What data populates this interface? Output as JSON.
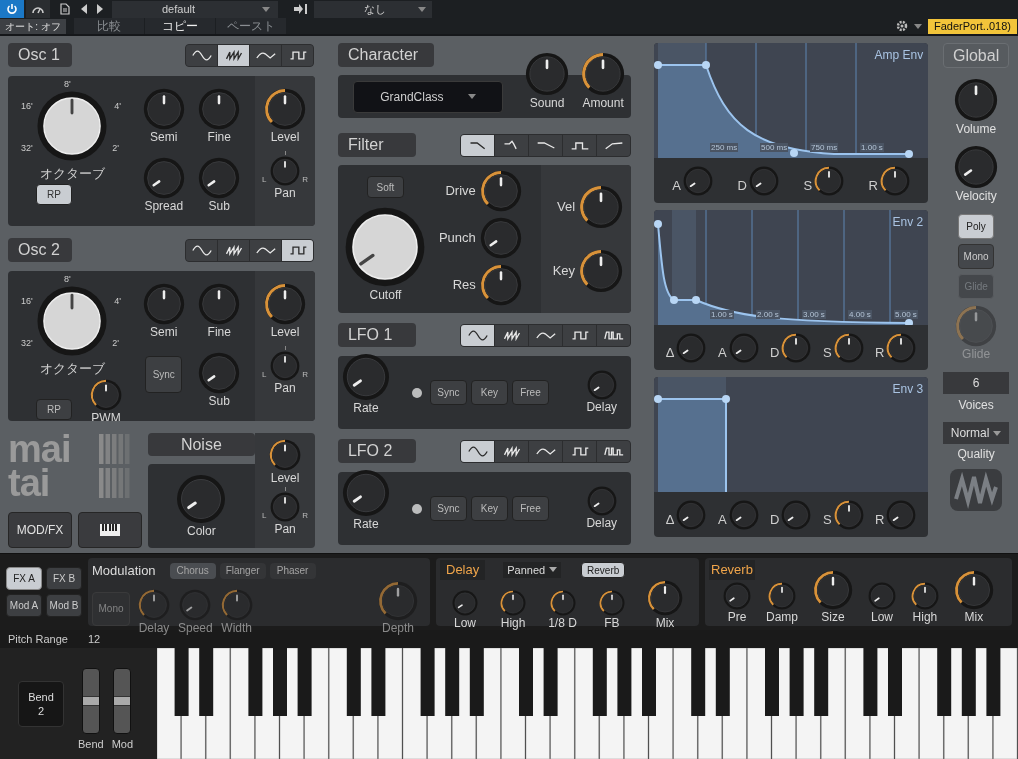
{
  "toolbar": {
    "power_on": true,
    "preset": "default",
    "sidechain": "なし",
    "auto": "オート: オフ",
    "actions": [
      {
        "label": "比較",
        "disabled": true
      },
      {
        "label": "コピー",
        "disabled": false
      },
      {
        "label": "ペースト",
        "disabled": true
      }
    ],
    "device": "FaderPort..018)"
  },
  "oscillators": [
    {
      "title": "Osc 1",
      "waves": [
        {
          "kind": "sine",
          "selected": false
        },
        {
          "kind": "saw",
          "selected": true
        },
        {
          "kind": "triangle",
          "selected": false
        },
        {
          "kind": "square",
          "selected": false
        }
      ],
      "octave": {
        "label": "オクターブ",
        "marks": [
          "8'",
          "16'",
          "4'",
          "32'",
          "2'"
        ]
      },
      "rp": {
        "label": "RP",
        "on": true
      },
      "controls": [
        {
          "kind": "centered",
          "label": "Semi",
          "arc": false
        },
        {
          "kind": "centered",
          "label": "Fine",
          "arc": false
        },
        {
          "kind": "knob",
          "label": "Spread",
          "arc": false
        },
        {
          "kind": "knob",
          "label": "Sub",
          "arc": false
        }
      ],
      "level": {
        "label": "Level",
        "kind": "knob",
        "arc": true
      },
      "pan": {
        "label": "Pan",
        "kind": "centered",
        "arc": false,
        "left": "L",
        "right": "R"
      }
    },
    {
      "title": "Osc 2",
      "waves": [
        {
          "kind": "sine",
          "selected": false
        },
        {
          "kind": "saw",
          "selected": false
        },
        {
          "kind": "triangle",
          "selected": false
        },
        {
          "kind": "square",
          "selected": true
        }
      ],
      "octave": {
        "label": "オクターブ",
        "marks": [
          "8'",
          "16'",
          "4'",
          "32'",
          "2'"
        ]
      },
      "rp": {
        "label": "RP",
        "on": false
      },
      "pwm": {
        "label": "PWM",
        "kind": "knob",
        "arc": true
      },
      "controls": [
        {
          "kind": "centered",
          "label": "Semi",
          "arc": false
        },
        {
          "kind": "centered",
          "label": "Fine",
          "arc": false
        },
        {
          "kind": "button",
          "label": "Sync",
          "on": false
        },
        {
          "kind": "knob",
          "label": "Sub",
          "arc": false
        }
      ],
      "level": {
        "label": "Level",
        "kind": "knob",
        "arc": true
      },
      "pan": {
        "label": "Pan",
        "kind": "centered",
        "arc": false,
        "left": "L",
        "right": "R"
      }
    }
  ],
  "logo": [
    "mai",
    "tai"
  ],
  "noise": {
    "title": "Noise",
    "color": {
      "label": "Color",
      "kind": "knob",
      "arc": false
    },
    "level": {
      "label": "Level",
      "kind": "knob",
      "arc": true
    },
    "pan": {
      "label": "Pan",
      "kind": "centered",
      "arc": false,
      "left": "L",
      "right": "R"
    }
  },
  "mod_fx_button": "MOD/FX",
  "character": {
    "title": "Character",
    "preset": "GrandClass",
    "knobs": [
      {
        "label": "Sound",
        "kind": "centered",
        "arc": false
      },
      {
        "label": "Amount",
        "kind": "knob",
        "arc": true
      }
    ]
  },
  "filter": {
    "title": "Filter",
    "types": [
      {
        "kind": "lowpass",
        "selected": true
      },
      {
        "kind": "peak",
        "selected": false
      },
      {
        "kind": "shelf",
        "selected": false
      },
      {
        "kind": "bandpass",
        "selected": false
      },
      {
        "kind": "highpass",
        "selected": false
      }
    ],
    "soft": {
      "label": "Soft",
      "on": false
    },
    "cutoff": {
      "label": "Cutoff",
      "kind": "knob",
      "arc": false
    },
    "knobs": [
      {
        "label": "Drive",
        "kind": "knob",
        "arc": true
      },
      {
        "label": "Punch",
        "kind": "knob",
        "arc": false
      },
      {
        "label": "Res",
        "kind": "knob",
        "arc": true
      }
    ],
    "tracking": [
      {
        "label": "Vel",
        "kind": "knob",
        "arc": true
      },
      {
        "label": "Key",
        "kind": "knob",
        "arc": true
      }
    ]
  },
  "lfos": [
    {
      "title": "LFO 1",
      "waves": [
        {
          "kind": "sine",
          "selected": true
        },
        {
          "kind": "saw",
          "selected": false
        },
        {
          "kind": "triangle",
          "selected": false
        },
        {
          "kind": "square",
          "selected": false
        },
        {
          "kind": "pulse",
          "selected": false
        }
      ],
      "rate": {
        "label": "Rate",
        "kind": "knob",
        "arc": false
      },
      "led_on": false,
      "buttons": [
        {
          "label": "Sync",
          "on": false
        },
        {
          "label": "Key",
          "on": false
        },
        {
          "label": "Free",
          "on": false
        }
      ],
      "delay": {
        "label": "Delay",
        "kind": "knob",
        "arc": false
      }
    },
    {
      "title": "LFO 2",
      "waves": [
        {
          "kind": "sine",
          "selected": true
        },
        {
          "kind": "saw",
          "selected": false
        },
        {
          "kind": "triangle",
          "selected": false
        },
        {
          "kind": "square",
          "selected": false
        },
        {
          "kind": "pulse",
          "selected": false
        }
      ],
      "rate": {
        "label": "Rate",
        "kind": "knob",
        "arc": false
      },
      "led_on": false,
      "buttons": [
        {
          "label": "Sync",
          "on": false
        },
        {
          "label": "Key",
          "on": false
        },
        {
          "label": "Free",
          "on": false
        }
      ],
      "delay": {
        "label": "Delay",
        "kind": "knob",
        "arc": false
      }
    }
  ],
  "envelopes": [
    {
      "title": "Amp Env",
      "ticks": [
        "250 ms",
        "500 ms",
        "750 ms",
        "1.00 s"
      ],
      "knobs": [
        {
          "label": "A",
          "kind": "knob",
          "arc": false
        },
        {
          "label": "D",
          "kind": "knob",
          "arc": false
        },
        {
          "label": "S",
          "kind": "knob",
          "arc": true
        },
        {
          "label": "R",
          "kind": "knob",
          "arc": true
        }
      ]
    },
    {
      "title": "Env 2",
      "ticks": [
        "1.00 s",
        "2.00 s",
        "3.00 s",
        "4.00 s",
        "5.00 s"
      ],
      "knobs": [
        {
          "label": "Δ",
          "kind": "knob",
          "arc": false
        },
        {
          "label": "A",
          "kind": "knob",
          "arc": false
        },
        {
          "label": "D",
          "kind": "knob",
          "arc": true
        },
        {
          "label": "S",
          "kind": "knob",
          "arc": true
        },
        {
          "label": "R",
          "kind": "knob",
          "arc": true
        }
      ]
    },
    {
      "title": "Env 3",
      "knobs": [
        {
          "label": "Δ",
          "kind": "knob",
          "arc": false
        },
        {
          "label": "A",
          "kind": "knob",
          "arc": false
        },
        {
          "label": "D",
          "kind": "knob",
          "arc": false
        },
        {
          "label": "S",
          "kind": "knob",
          "arc": true
        },
        {
          "label": "R",
          "kind": "knob",
          "arc": false
        }
      ]
    }
  ],
  "global": {
    "title": "Global",
    "knobs": [
      {
        "label": "Volume",
        "kind": "centered",
        "arc": false
      },
      {
        "label": "Velocity",
        "kind": "knob",
        "arc": false
      }
    ],
    "modes": [
      {
        "label": "Poly",
        "selected": true,
        "disabled": false
      },
      {
        "label": "Mono",
        "selected": false,
        "disabled": false
      },
      {
        "label": "Glide",
        "selected": false,
        "disabled": true
      }
    ],
    "glide": {
      "label": "Glide",
      "kind": "knob",
      "arc": true,
      "disabled": true
    },
    "voices": {
      "value": "6",
      "label": "Voices"
    },
    "quality": {
      "value": "Normal",
      "label": "Quality"
    }
  },
  "fx_tabs": [
    {
      "label": "FX A",
      "selected": true
    },
    {
      "label": "FX B",
      "selected": false
    },
    {
      "label": "Mod A",
      "selected": false
    },
    {
      "label": "Mod B",
      "selected": false
    }
  ],
  "modulation": {
    "title": "Modulation",
    "disabled": true,
    "types": [
      {
        "label": "Chorus",
        "selected": true
      },
      {
        "label": "Flanger",
        "selected": false
      },
      {
        "label": "Phaser",
        "selected": false
      }
    ],
    "mono": "Mono",
    "knobs": [
      {
        "label": "Delay",
        "kind": "knob",
        "arc": true
      },
      {
        "label": "Speed",
        "kind": "knob",
        "arc": false
      },
      {
        "label": "Width",
        "kind": "knob",
        "arc": true
      }
    ],
    "depth": {
      "label": "Depth",
      "kind": "knob",
      "arc": true
    }
  },
  "delay": {
    "title": "Delay",
    "mode": "Panned",
    "reverb": {
      "label": "Reverb",
      "on": true
    },
    "knobs": [
      {
        "label": "Low",
        "kind": "knob",
        "arc": false
      },
      {
        "label": "High",
        "kind": "knob",
        "arc": true
      },
      {
        "label": "1/8 D",
        "kind": "knob",
        "arc": true
      },
      {
        "label": "FB",
        "kind": "knob",
        "arc": true
      },
      {
        "label": "Mix",
        "kind": "knob",
        "arc": true
      }
    ]
  },
  "reverb": {
    "title": "Reverb",
    "knobs": [
      {
        "label": "Pre",
        "kind": "knob",
        "arc": false
      },
      {
        "label": "Damp",
        "kind": "knob",
        "arc": true
      },
      {
        "label": "Size",
        "kind": "knob",
        "arc": true
      },
      {
        "label": "Low",
        "kind": "knob",
        "arc": false
      },
      {
        "label": "High",
        "kind": "knob",
        "arc": true
      },
      {
        "label": "Mix",
        "kind": "knob",
        "arc": true
      }
    ]
  },
  "pitch_range": {
    "label": "Pitch Range",
    "value": "12"
  },
  "bend_box": {
    "label": "Bend",
    "value": "2"
  },
  "wheels": [
    {
      "label": "Bend"
    },
    {
      "label": "Mod"
    }
  ]
}
